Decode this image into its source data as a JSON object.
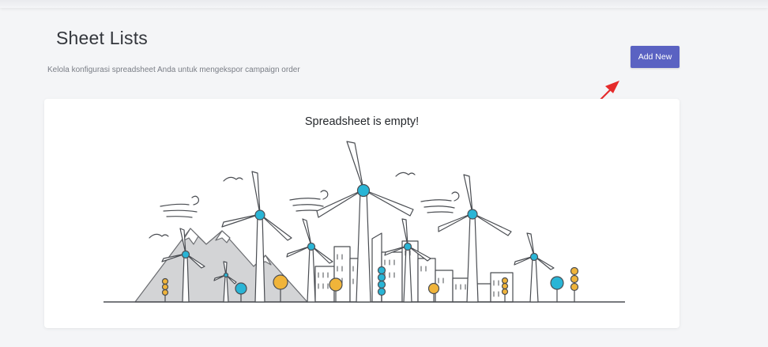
{
  "header": {
    "title": "Sheet Lists",
    "subtitle": "Kelola konfigurasi spreadsheet Anda untuk mengekspor campaign order"
  },
  "actions": {
    "add_new_label": "Add New",
    "accent_color": "#5a62c2",
    "annotation_arrow_color": "#e52b2b"
  },
  "empty_state": {
    "message": "Spreadsheet is empty!",
    "illustration": "wind-turbines-city-illustration"
  }
}
